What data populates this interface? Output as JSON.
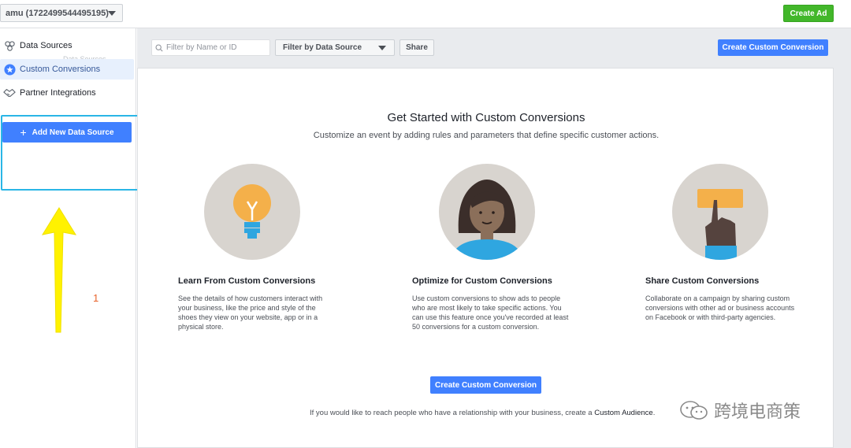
{
  "header": {
    "account_label": "amu (1722499544495195)",
    "create_ad_label": "Create Ad"
  },
  "sidebar": {
    "items": [
      {
        "label": "Data Sources",
        "icon": "data-sources-icon"
      },
      {
        "label": "Custom Conversions",
        "icon": "star-badge-icon"
      },
      {
        "label": "Partner Integrations",
        "icon": "handshake-icon"
      }
    ],
    "ghost_label": "Data Sources",
    "add_button_label": "Add New Data Source"
  },
  "annotation": {
    "number": "1",
    "box_color": "#2ab6e6",
    "arrow_color": "#fff200"
  },
  "toolbar": {
    "search_placeholder": "Filter by Name or ID",
    "filter_label": "Filter by Data Source",
    "share_label": "Share",
    "create_label": "Create Custom Conversion"
  },
  "main": {
    "heading": "Get Started with Custom Conversions",
    "subheading": "Customize an event by adding rules and parameters that define specific customer actions.",
    "features": [
      {
        "title": "Learn From Custom Conversions",
        "description": "See the details of how customers interact with your business, like the price and style of the shoes they view on your website, app or in a physical store.",
        "icon": "lightbulb-icon"
      },
      {
        "title": "Optimize for Custom Conversions",
        "description": "Use custom conversions to show ads to people who are most likely to take specific actions. You can use this feature once you've recorded at least 50 conversions for a custom conversion.",
        "icon": "person-icon"
      },
      {
        "title": "Share Custom Conversions",
        "description": "Collaborate on a campaign by sharing custom conversions with other ad or business accounts on Facebook or with third-party agencies.",
        "icon": "pointing-hand-icon"
      }
    ],
    "create_button_label": "Create Custom Conversion",
    "bottom_note_prefix": "If you would like to reach people who have a relationship with your business, create a ",
    "bottom_note_link": "Custom Audience",
    "bottom_note_suffix": "."
  },
  "watermark": {
    "text": "跨境电商策"
  },
  "colors": {
    "primary_blue": "#4080ff",
    "green": "#42b72a",
    "active_bg": "#e7f0fd",
    "illustration_bg": "#d8d4cf"
  }
}
